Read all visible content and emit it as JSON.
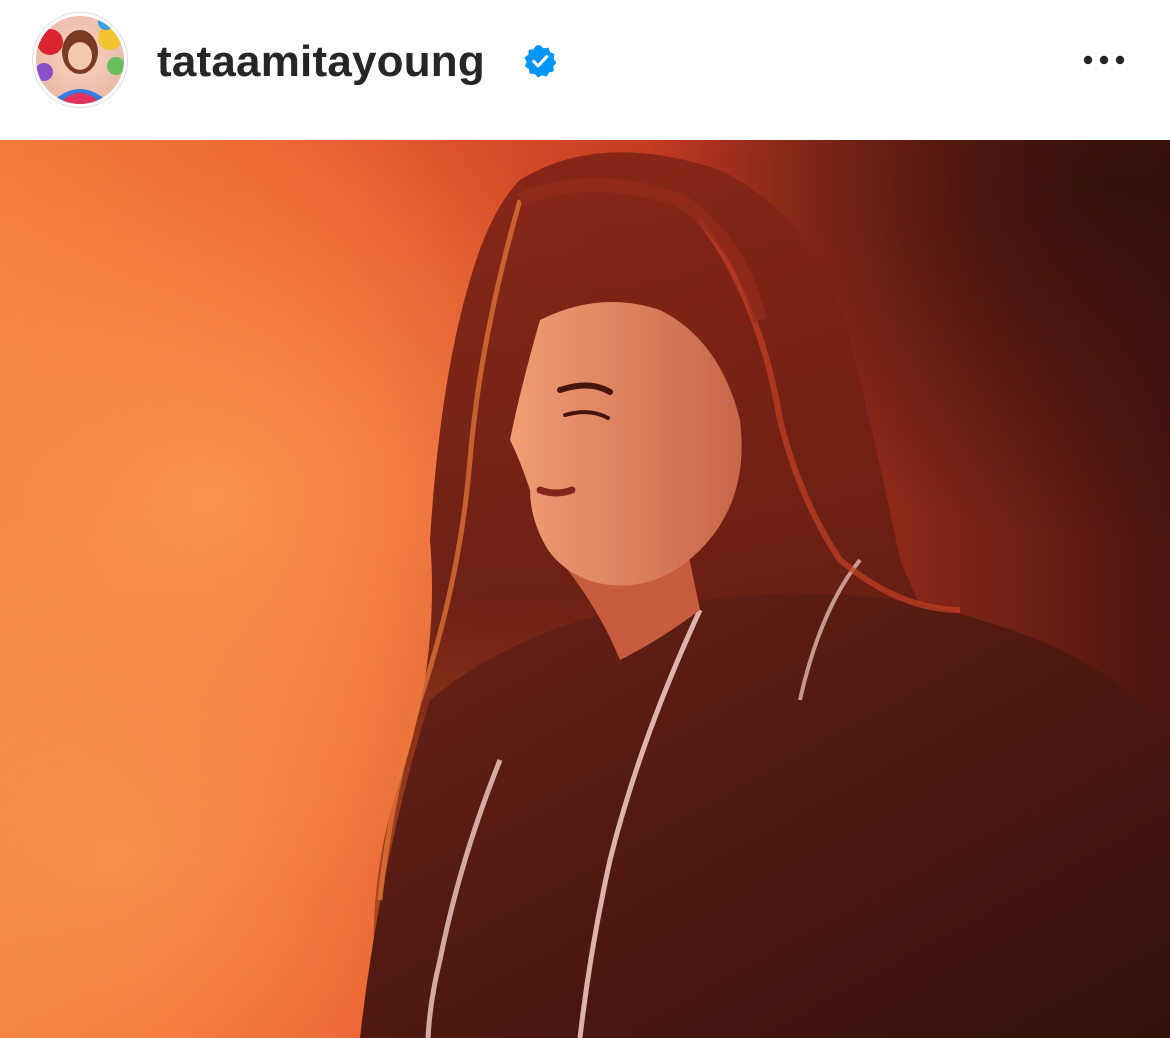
{
  "post": {
    "username": "tataamitayoung",
    "verified": true,
    "icons": {
      "verified": "verified-badge-icon",
      "more": "more-options-icon"
    },
    "colors": {
      "verified_badge": "#0095f6",
      "username_text": "#262626",
      "photo_warm": "#e8562a",
      "photo_dark": "#3a0c0c"
    }
  }
}
